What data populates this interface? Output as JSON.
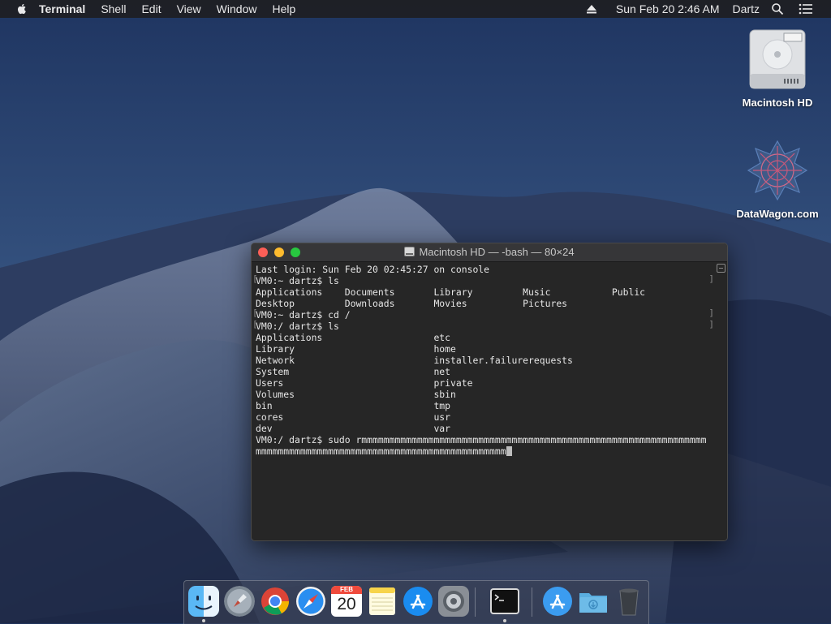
{
  "menubar": {
    "app_name": "Terminal",
    "items": [
      "Shell",
      "Edit",
      "View",
      "Window",
      "Help"
    ],
    "clock": "Sun Feb 20  2:46 AM",
    "user": "Dartz"
  },
  "desktop_icons": [
    {
      "label": "Macintosh HD",
      "icon": "hard-drive-icon"
    },
    {
      "label": "DataWagon.com",
      "icon": "datawagon-icon"
    }
  ],
  "terminal": {
    "title": "Macintosh HD — -bash — 80×24",
    "lines": [
      "Last login: Sun Feb 20 02:45:27 on console",
      "VM0:~ dartz$ ls",
      "Applications    Documents       Library         Music           Public",
      "Desktop         Downloads       Movies          Pictures",
      "VM0:~ dartz$ cd /",
      "VM0:/ dartz$ ls",
      "Applications                    etc",
      "Library                         home",
      "Network                         installer.failurerequests",
      "System                          net",
      "Users                           private",
      "Volumes                         sbin",
      "bin                             tmp",
      "cores                           usr",
      "dev                             var",
      "VM0:/ dartz$ sudo rmmmmmmmmmmmmmmmmmmmmmmmmmmmmmmmmmmmmmmmmmmmmmmmmmmmmmmmmmmmmmm",
      "mmmmmmmmmmmmmmmmmmmmmmmmmmmmmmmmmmmmmmmmmmmmm"
    ]
  },
  "dock": {
    "apps": [
      "Finder",
      "Launchpad",
      "Google Chrome",
      "Safari",
      "Calendar",
      "Notes",
      "App Store",
      "System Preferences",
      "Terminal",
      "Applications",
      "Downloads",
      "Trash"
    ],
    "calendar_month": "FEB",
    "calendar_day": "20"
  }
}
